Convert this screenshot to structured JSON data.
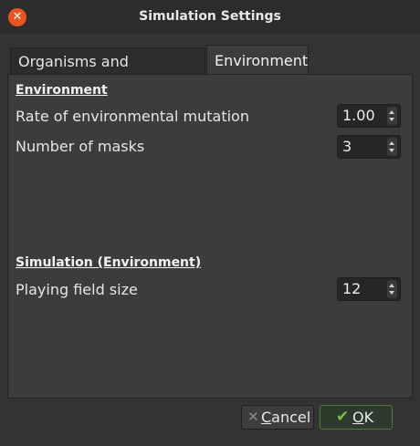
{
  "window": {
    "title": "Simulation Settings",
    "close_icon": "close-icon"
  },
  "tabs": [
    {
      "label": "Organisms and simulation",
      "selected": false
    },
    {
      "label": "Environment",
      "selected": true
    }
  ],
  "environment_section": {
    "heading": "Environment",
    "rows": [
      {
        "label": "Rate of environmental mutation",
        "value": "1.00"
      },
      {
        "label": "Number of masks",
        "value": "3"
      }
    ]
  },
  "simulation_section": {
    "heading": "Simulation (Environment)",
    "rows": [
      {
        "label": "Playing field size",
        "value": "12"
      }
    ]
  },
  "buttons": {
    "cancel": {
      "mnemonic": "C",
      "rest": "ancel",
      "icon": "x-icon"
    },
    "ok": {
      "mnemonic": "O",
      "rest": "K",
      "icon": "checkmark-icon"
    }
  },
  "colors": {
    "close_button": "#e95420",
    "ok_accent": "#78c04a",
    "background": "#333333",
    "panel": "#3c3c3c"
  }
}
